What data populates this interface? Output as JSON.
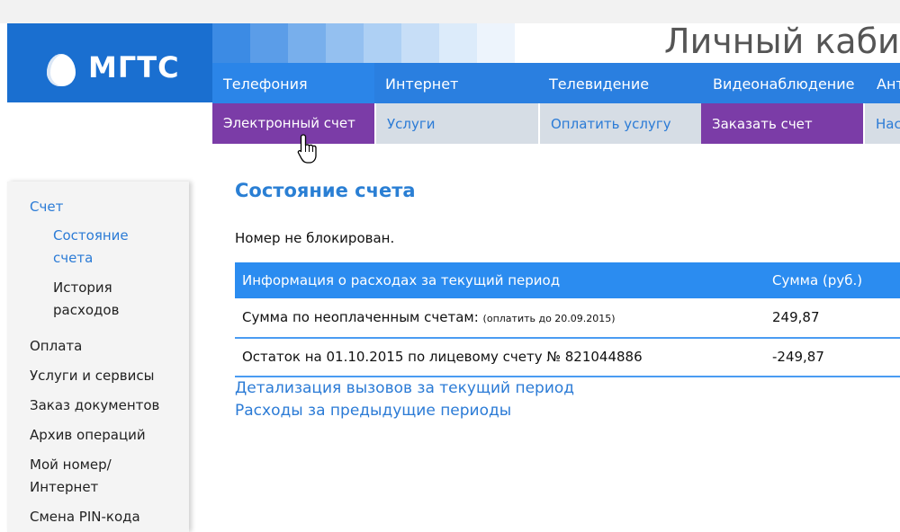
{
  "brand": {
    "name": "МГТС",
    "logo_icon": "egg-logo-icon"
  },
  "page_title": "Личный каби",
  "nav_primary": [
    {
      "label": "Телефония"
    },
    {
      "label": "Интернет"
    },
    {
      "label": "Телевидение"
    },
    {
      "label": "Видеонаблюдение"
    },
    {
      "label": "Ант"
    }
  ],
  "nav_secondary": [
    {
      "label": "Электронный счет"
    },
    {
      "label": "Услуги"
    },
    {
      "label": "Оплатить услугу"
    },
    {
      "label": "Заказать счет"
    },
    {
      "label": "Нас"
    }
  ],
  "sidebar": {
    "section": "Счет",
    "sub_items": [
      {
        "label": "Состояние счета"
      },
      {
        "label": "История расходов"
      }
    ],
    "items": [
      {
        "label": "Оплата"
      },
      {
        "label": "Услуги и сервисы"
      },
      {
        "label": "Заказ документов"
      },
      {
        "label": "Архив операций"
      },
      {
        "label": "Мой номер/Интернет"
      },
      {
        "label": "Смена PIN-кода"
      }
    ]
  },
  "main": {
    "heading": "Состояние счета",
    "status": "Номер не блокирован.",
    "table": {
      "headers": [
        "Информация о расходах за текущий период",
        "Сумма (руб.)"
      ],
      "rows": [
        {
          "label": "Сумма по неоплаченным счетам:",
          "note": "(оплатить до 20.09.2015)",
          "amount": "249,87"
        },
        {
          "label": "Остаток на 01.10.2015 по лицевому счету № 821044886",
          "note": "",
          "amount": "-249,87"
        }
      ]
    },
    "links": [
      "Детализация вызовов за текущий период",
      "Расходы за предыдущие периоды"
    ]
  },
  "colors": {
    "brand_blue": "#1a6fd0",
    "nav_blue": "#2b85e8",
    "accent_purple": "#7b3ca7",
    "link_blue": "#2b7bd6"
  }
}
